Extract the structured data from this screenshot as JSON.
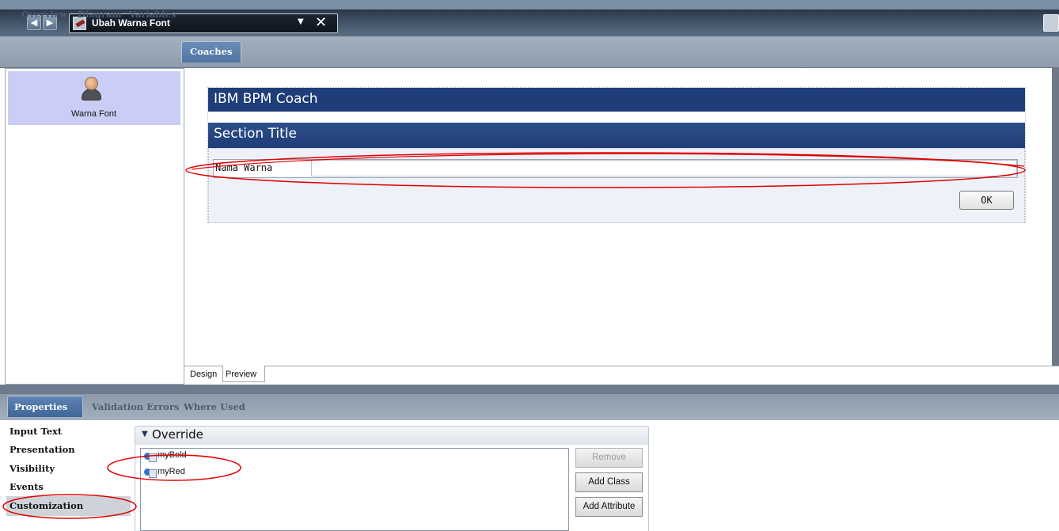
{
  "title_bar": {
    "nav_back_icon": "triangle-left",
    "nav_forward_icon": "triangle-right",
    "document_title": "Ubah Warna Font",
    "dropdown_icon": "▼",
    "close_icon": "✕"
  },
  "editor_tabs": [
    "Overview",
    "Diagram",
    "Variables",
    "Coaches"
  ],
  "active_editor_tab": "Coaches",
  "coach_list": [
    {
      "label": "Warna Font",
      "icon": "person-icon"
    }
  ],
  "canvas": {
    "coach_header": "IBM BPM Coach",
    "section_title": "Section Title",
    "field_label": "Nama Warna",
    "field_value": "",
    "ok_button": "OK"
  },
  "view_tabs": {
    "design": "Design",
    "preview": "Preview"
  },
  "properties": {
    "tabs": [
      "Properties",
      "Validation Errors",
      "Where Used"
    ],
    "active_tab": "Properties",
    "nav_items": [
      "Input Text",
      "Presentation",
      "Visibility",
      "Events",
      "Customization"
    ],
    "selected_nav": "Customization",
    "override_label": "Override",
    "classes": [
      "myBold",
      "myRed"
    ],
    "buttons": {
      "remove": "Remove",
      "add_class": "Add Class",
      "add_attribute": "Add Attribute"
    }
  },
  "colors": {
    "annotation": "#e00000",
    "coach_header": "#1f3d78",
    "active_tab": "#4e74a3"
  }
}
